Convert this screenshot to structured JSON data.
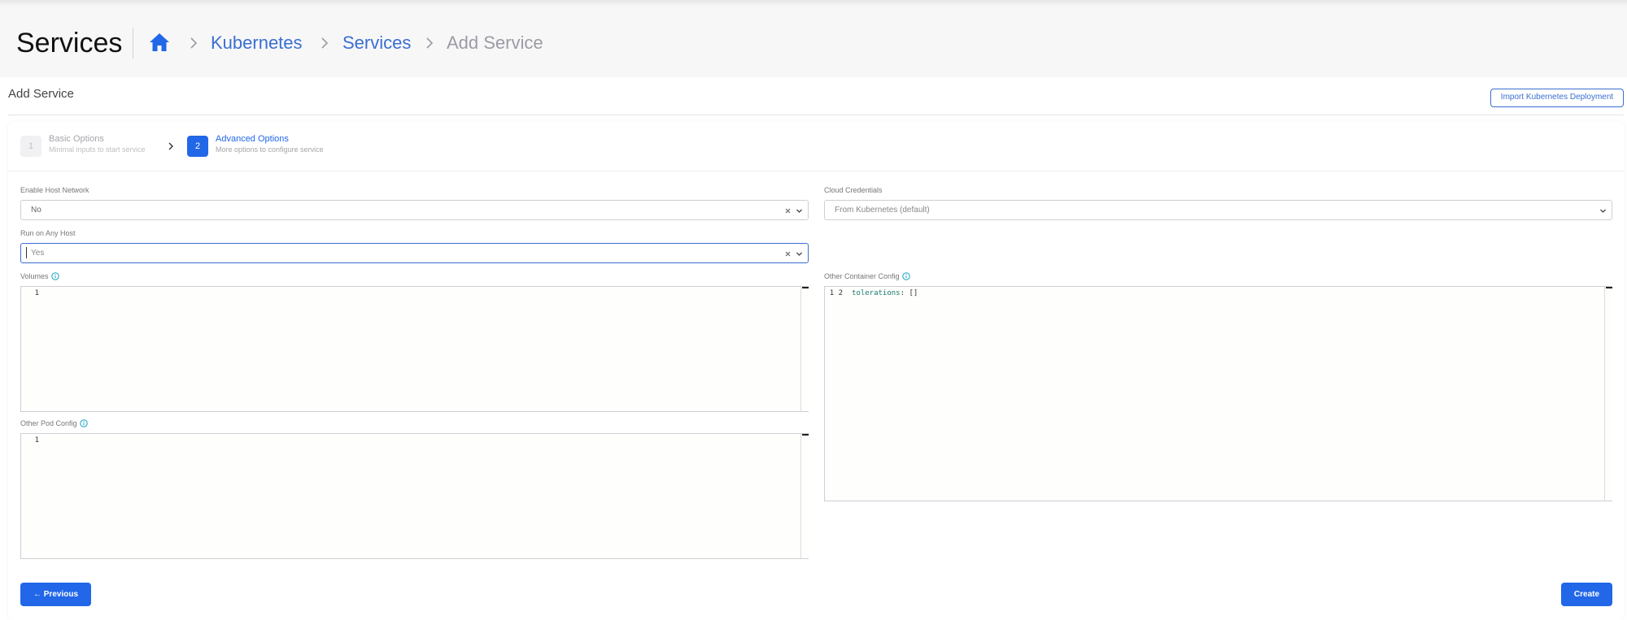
{
  "header": {
    "title": "Services",
    "breadcrumbs": [
      {
        "label": "Kubernetes"
      },
      {
        "label": "Services"
      },
      {
        "label": "Add Service"
      }
    ]
  },
  "section": {
    "title": "Add Service",
    "import_label": "Import Kubernetes Deployment"
  },
  "steps": [
    {
      "number": "1",
      "title": "Basic Options",
      "subtitle": "Minimal inputs to start service",
      "active": false
    },
    {
      "number": "2",
      "title": "Advanced Options",
      "subtitle": "More options to configure service",
      "active": true
    }
  ],
  "form": {
    "host_network": {
      "label": "Enable Host Network",
      "value": "No"
    },
    "cloud_credentials": {
      "label": "Cloud Credentials",
      "value": "From Kubernetes (default)"
    },
    "run_on_any_host": {
      "label": "Run on Any Host",
      "value": "Yes"
    },
    "volumes": {
      "label": "Volumes",
      "line_numbers": "1",
      "code": ""
    },
    "other_container_config": {
      "label": "Other Container Config",
      "line_numbers": "1\n2",
      "code_key": "tolerations",
      "code_rest": ": []"
    },
    "other_pod_config": {
      "label": "Other Pod Config",
      "line_numbers": "1",
      "code": ""
    }
  },
  "footer": {
    "previous_label": "Previous",
    "create_label": "Create"
  },
  "colors": {
    "primary": "#2167e8",
    "link": "#3a6fd1",
    "info": "#17a2c4"
  }
}
